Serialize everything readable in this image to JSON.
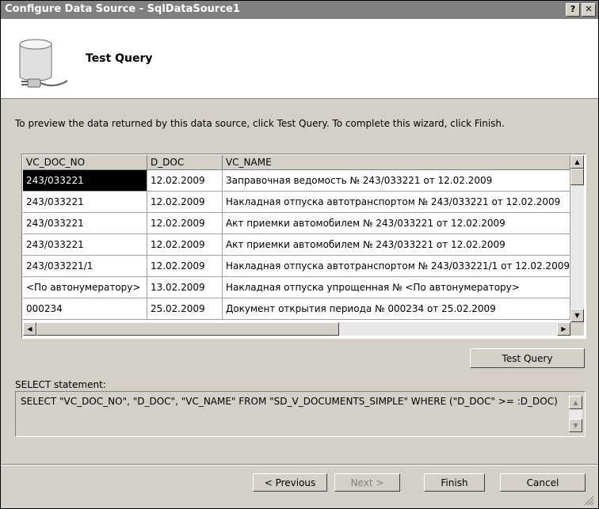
{
  "window": {
    "title": "Configure Data Source - SqlDataSource1",
    "help_label": "?",
    "close_label": "✕"
  },
  "header": {
    "title": "Test Query",
    "icon": "database-icon"
  },
  "instructions": "To preview the data returned by this data source, click Test Query. To complete this wizard, click Finish.",
  "grid": {
    "columns": [
      "VC_DOC_NO",
      "D_DOC",
      "VC_NAME"
    ],
    "rows": [
      [
        "243/033221",
        "12.02.2009",
        "Заправочная ведомость № 243/033221 от 12.02.2009"
      ],
      [
        "243/033221",
        "12.02.2009",
        "Накладная отпуска автотранспортом № 243/033221 от 12.02.2009"
      ],
      [
        "243/033221",
        "12.02.2009",
        "Акт приемки автомобилем № 243/033221 от 12.02.2009"
      ],
      [
        "243/033221",
        "12.02.2009",
        "Акт приемки автомобилем № 243/033221 от 12.02.2009"
      ],
      [
        "243/033221/1",
        "12.02.2009",
        "Накладная отпуска автотранспортом № 243/033221/1 от 12.02.2009"
      ],
      [
        "<По автонумератору>",
        "13.02.2009",
        "Накладная отпуска упрощенная № <По автонумератору>"
      ],
      [
        "000234",
        "25.02.2009",
        "Документ открытия периода № 000234 от 25.02.2009"
      ]
    ]
  },
  "buttons": {
    "test_query": "Test Query",
    "previous": "< Previous",
    "next": "Next >",
    "finish": "Finish",
    "cancel": "Cancel"
  },
  "select_statement": {
    "label": "SELECT statement:",
    "text": "SELECT \"VC_DOC_NO\", \"D_DOC\", \"VC_NAME\" FROM \"SD_V_DOCUMENTS_SIMPLE\" WHERE (\"D_DOC\" >= :D_DOC)"
  },
  "colors": {
    "titlebar": "#808080",
    "dialog": "#d4d0c8",
    "selected_cell": "#000000"
  }
}
